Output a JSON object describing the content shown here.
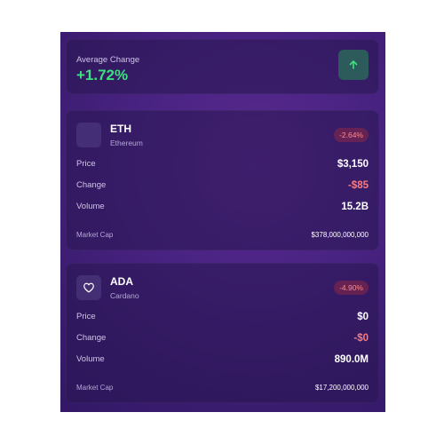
{
  "summary": {
    "label": "Average Change",
    "value": "+1.72%",
    "button_icon": "arrow-up-icon",
    "accent": "#3ee07f"
  },
  "coins": [
    {
      "symbol": "ETH",
      "name": "Ethereum",
      "change_badge": "-2.64%",
      "icon": "blank-icon",
      "rows": {
        "price_label": "Price",
        "price": "$3,150",
        "change_label": "Change",
        "change": "-$85",
        "volume_label": "Volume",
        "volume": "15.2B"
      },
      "market_cap_label": "Market Cap",
      "market_cap": "$378,000,000,000"
    },
    {
      "symbol": "ADA",
      "name": "Cardano",
      "change_badge": "-4.90%",
      "icon": "heart-icon",
      "rows": {
        "price_label": "Price",
        "price": "$0",
        "change_label": "Change",
        "change": "-$0",
        "volume_label": "Volume",
        "volume": "890.0M"
      },
      "market_cap_label": "Market Cap",
      "market_cap": "$17,200,000,000"
    }
  ],
  "colors": {
    "positive": "#3ee07f",
    "negative": "#ff7a7a",
    "background": "#4b2484"
  }
}
